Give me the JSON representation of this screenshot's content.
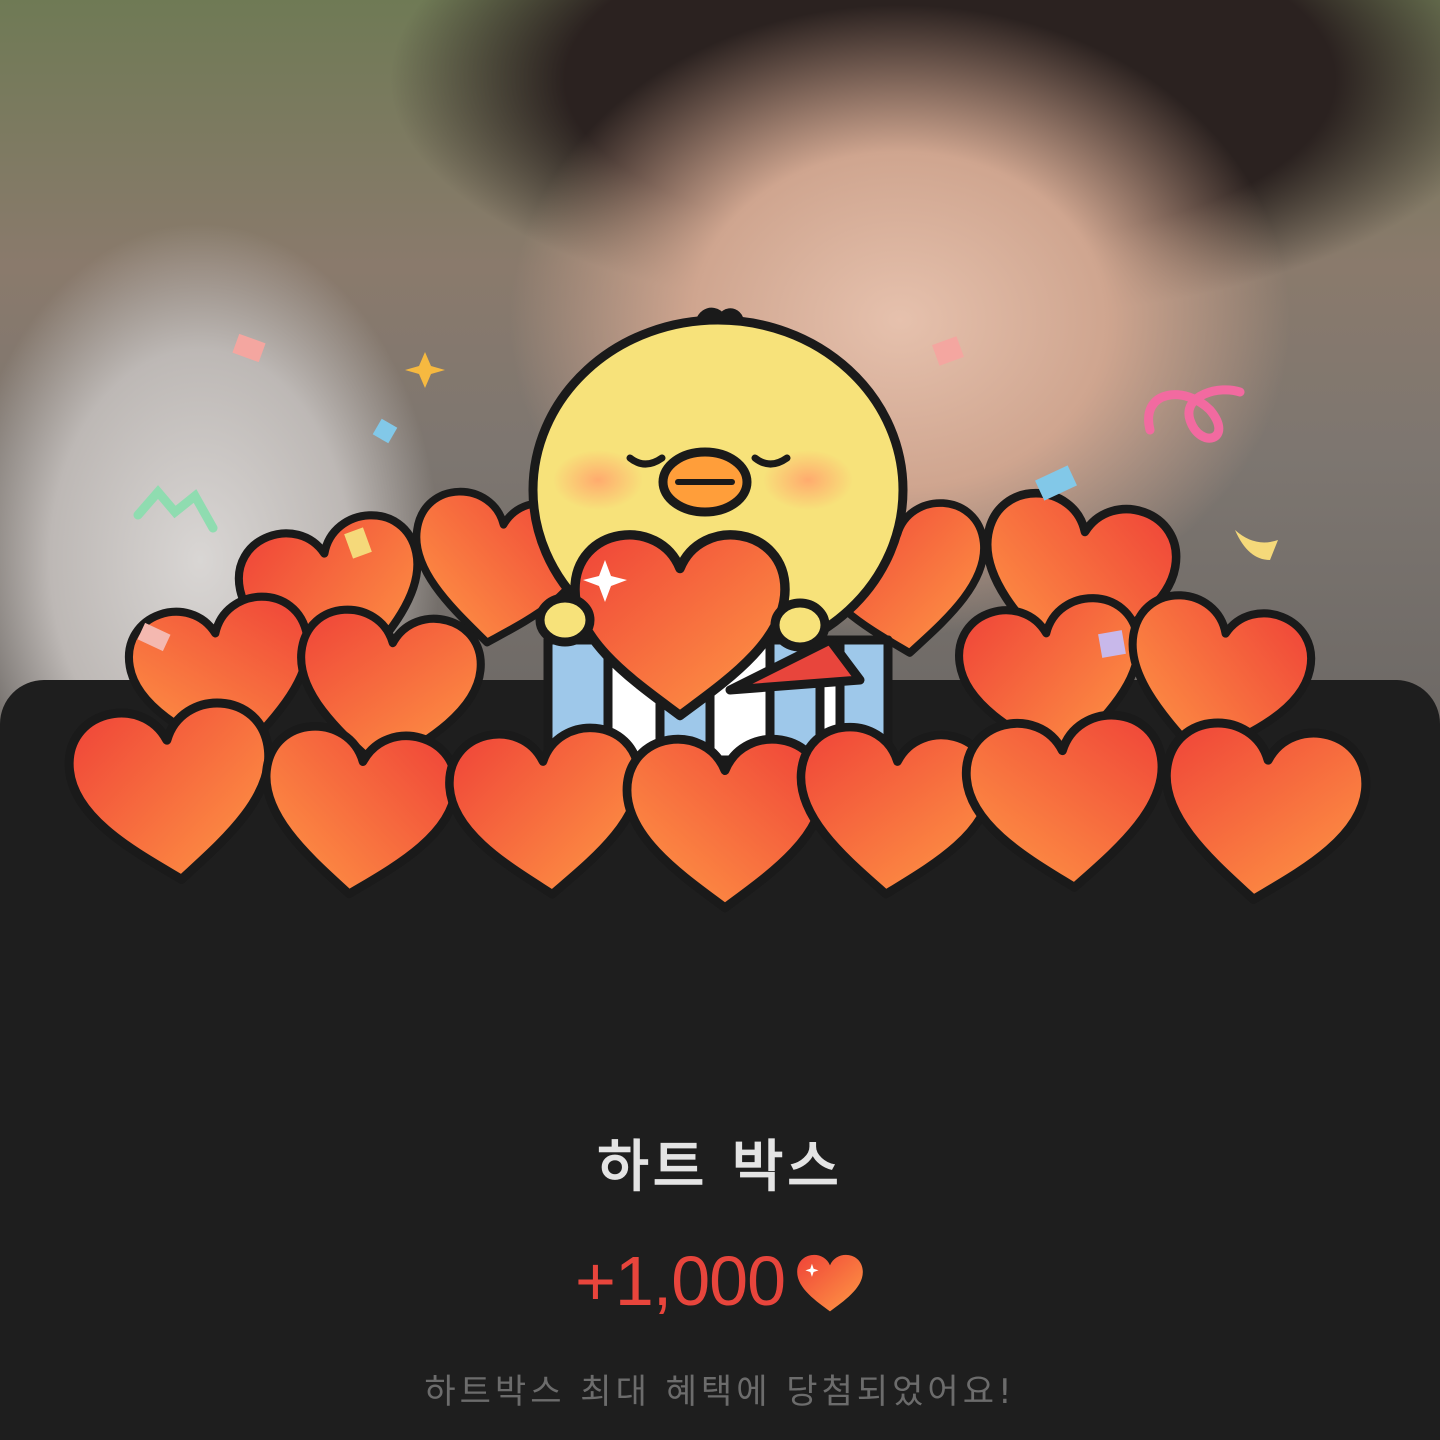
{
  "dialog": {
    "title": "하트 박스",
    "reward_amount": "+1,000",
    "reward_icon": "heart-icon",
    "message": "하트박스 최대 혜택에 당첨되었어요!"
  },
  "colors": {
    "heart_top": "#ff8a3d",
    "heart_bottom": "#f0443a",
    "reward_text": "#e8453c",
    "sheet_bg": "#1e1e1e",
    "chick": "#f7e27a"
  }
}
